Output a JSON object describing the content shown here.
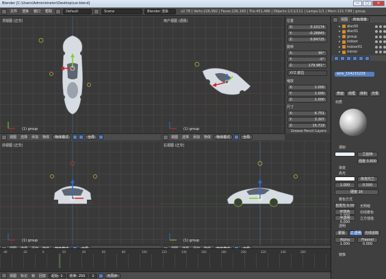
{
  "window": {
    "title": "Blender [C:\\Users\\Administrator\\Desktop\\car.blend]",
    "controls": [
      "—",
      "□",
      "✕"
    ]
  },
  "infobar": {
    "menus": [
      "文件",
      "渲染",
      "窗口",
      "帮助"
    ],
    "layout": "Default",
    "scene": "Scene",
    "engine": "Blender 渲染",
    "stats": "v2.78 | Verts:226,992 | Faces:226,160 | Tris:451,486 | Objects:1/11/111 | Lamps:1/1 | Mem:115.73M | group"
  },
  "outliner": {
    "search_label": "视图",
    "add_label": "所有场景",
    "items": [
      {
        "label": "disc00"
      },
      {
        "label": "disc01"
      },
      {
        "label": "group"
      },
      {
        "label": "indoor"
      },
      {
        "label": "indoor01"
      },
      {
        "label": "mirror"
      }
    ]
  },
  "properties": {
    "object_name": "wire_154215229",
    "material_label": "材质",
    "tabs": [
      "表面",
      "线框",
      "体积",
      "光晕"
    ],
    "diffuse_label": "漫射",
    "diffuse_shader": "兰伯特",
    "intensity_label": "强度",
    "intensity_value": "0.800",
    "ramp_label": "渐变",
    "specular_label": "高光",
    "specular_shader": "库克托兰",
    "spec_intensity": "1.000",
    "spec_intensity2": "0.500",
    "hardness_label": "硬度",
    "hardness_value": "16",
    "shading_label": "着色方式",
    "emit_label": "自发光",
    "emit_value": "0.00",
    "ambient_label": "环境色",
    "ambient_value": "1.000",
    "translucency_label": "半透明",
    "translucency_value": "0.000",
    "shadeless": "无明暗",
    "tangent": "切线着色",
    "cubic": "立方插值",
    "transparency_label": "透明",
    "transp_tabs": [
      "蒙版",
      "Z 透明",
      "光线追踪"
    ],
    "alpha_label": "Alpha",
    "alpha_value": "1.000",
    "fresnel_label": "Fresnel",
    "fresnel_value": "0.000",
    "mirror_label": "镜像"
  },
  "transform": {
    "location_label": "位置",
    "location": [
      {
        "axis": "X:",
        "val": "0.10174"
      },
      {
        "axis": "Y:",
        "val": "-0.28845"
      },
      {
        "axis": "Z:",
        "val": "0.84725"
      }
    ],
    "rotation_label": "旋转",
    "rotation": [
      {
        "axis": "X:",
        "val": "90°"
      },
      {
        "axis": "Y:",
        "val": "-0°"
      },
      {
        "axis": "Z:",
        "val": "179.981°"
      }
    ],
    "rotation_mode": "XYZ 欧拉",
    "scale_label": "缩放",
    "scale": [
      {
        "axis": "X:",
        "val": "1.000"
      },
      {
        "axis": "Y:",
        "val": "1.000"
      },
      {
        "axis": "Z:",
        "val": "1.000"
      }
    ],
    "dimensions_label": "尺寸",
    "dimensions": [
      {
        "axis": "X:",
        "val": "6.751"
      },
      {
        "axis": "Y:",
        "val": "3.307"
      },
      {
        "axis": "Z:",
        "val": "15.719"
      }
    ],
    "grease_label": "Grease Pencil Layers"
  },
  "viewports": [
    {
      "label": "顶视图 (正交)",
      "foot": "(1) group",
      "mode": "物体模式",
      "menus": [
        "视图",
        "选择",
        "添加",
        "物体"
      ],
      "global": "全局"
    },
    {
      "label": "用户视图 (透视)",
      "foot": "(1) group",
      "mode": "物体模式",
      "menus": [
        "视图",
        "选择",
        "添加",
        "物体"
      ],
      "global": "全局"
    },
    {
      "label": "前视图 (正交)",
      "foot": "(1) group",
      "mode": "物体模式",
      "menus": [
        "视图",
        "选择",
        "添加",
        "物体"
      ],
      "global": "全局"
    },
    {
      "label": "右视图 (正交)",
      "foot": "(1) group",
      "mode": "物体模式",
      "menus": [
        "视图",
        "选择",
        "添加",
        "物体"
      ],
      "global": "全局"
    }
  ],
  "timeline": {
    "ticks": [
      "-40",
      "-20",
      "0",
      "20",
      "40",
      "60",
      "80",
      "100",
      "120",
      "140",
      "160",
      "180",
      "200",
      "220",
      "240",
      "260"
    ],
    "menus": [
      "视图",
      "标记",
      "帧",
      "回放"
    ],
    "start_label": "起始:",
    "start_value": "1",
    "end_label": "结束:",
    "end_value": "250",
    "current_value": "1",
    "sync": "无同步"
  }
}
